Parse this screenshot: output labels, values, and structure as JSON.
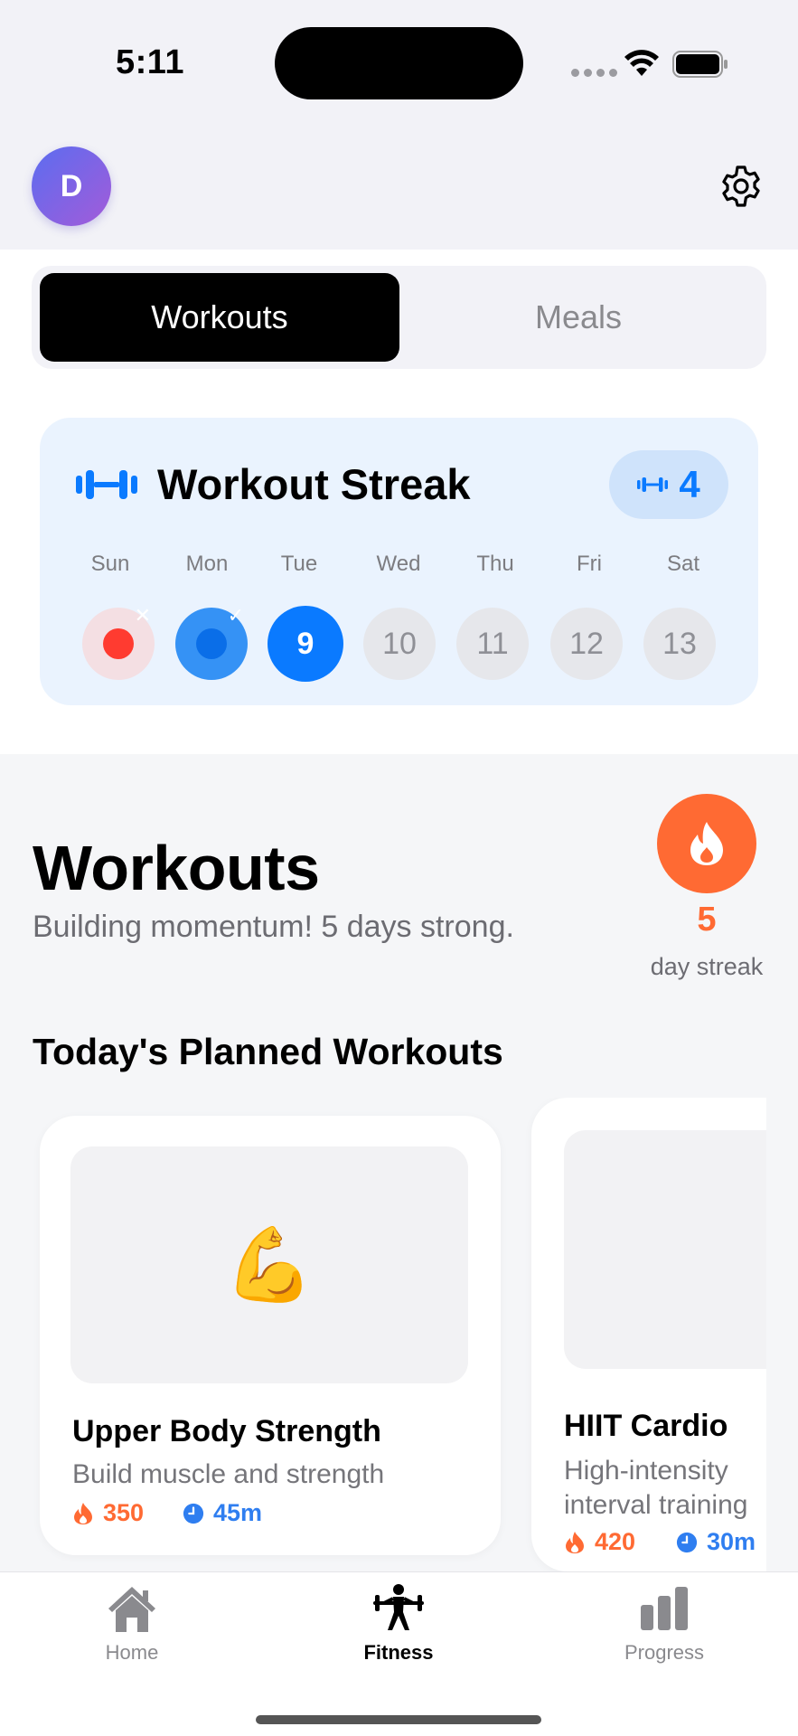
{
  "status_bar": {
    "time": "5:11"
  },
  "header": {
    "avatar_initial": "D"
  },
  "segmented": {
    "active": "Workouts",
    "inactive": "Meals"
  },
  "streak_card": {
    "title": "Workout Streak",
    "badge_count": "4",
    "accent_color": "#0a7aff",
    "days": [
      {
        "name": "Sun",
        "date": "",
        "state": "missed"
      },
      {
        "name": "Mon",
        "date": "",
        "state": "done"
      },
      {
        "name": "Tue",
        "date": "9",
        "state": "today"
      },
      {
        "name": "Wed",
        "date": "10",
        "state": "future"
      },
      {
        "name": "Thu",
        "date": "11",
        "state": "future"
      },
      {
        "name": "Fri",
        "date": "12",
        "state": "future"
      },
      {
        "name": "Sat",
        "date": "13",
        "state": "future"
      }
    ]
  },
  "workouts": {
    "title": "Workouts",
    "subtitle": "Building momentum! 5 days strong.",
    "streak_number": "5",
    "streak_label": "day streak",
    "flame_color": "#ff6a33",
    "planned_title": "Today's Planned Workouts",
    "cards": [
      {
        "emoji": "💪",
        "name": "Upper Body Strength",
        "description": "Build muscle and strength",
        "calories": "350",
        "duration": "45m"
      },
      {
        "emoji": "🔥",
        "name": "HIIT Cardio",
        "description": "High-intensity interval training",
        "calories": "420",
        "duration": "30m"
      }
    ]
  },
  "tabbar": {
    "tabs": [
      {
        "label": "Home",
        "icon": "house-icon"
      },
      {
        "label": "Fitness",
        "icon": "weightlifter-icon"
      },
      {
        "label": "Progress",
        "icon": "bar-chart-icon"
      }
    ],
    "active": "Fitness"
  }
}
